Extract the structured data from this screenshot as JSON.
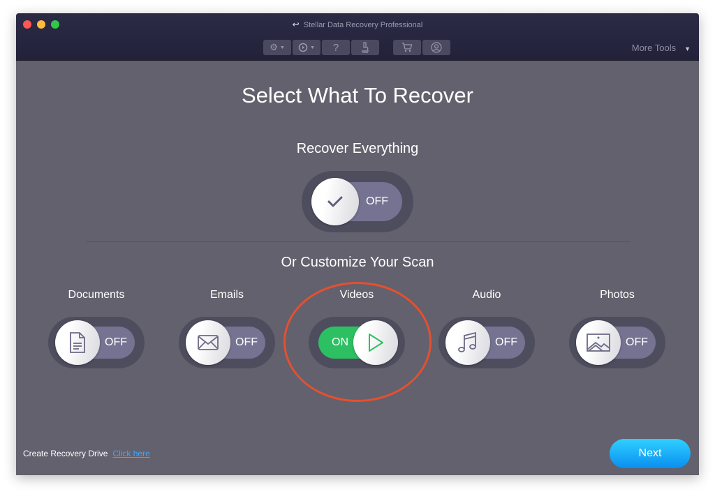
{
  "window": {
    "title": "Stellar Data Recovery Professional",
    "more_tools_label": "More Tools",
    "toolbar": [
      {
        "icon": "gear-icon",
        "has_dropdown": true
      },
      {
        "icon": "history-icon",
        "has_dropdown": true
      },
      {
        "icon": "help-icon",
        "label": "?"
      },
      {
        "icon": "microscope-icon"
      },
      {
        "icon": "cart-icon"
      },
      {
        "icon": "user-icon"
      }
    ]
  },
  "main": {
    "heading": "Select What To Recover",
    "recover_everything": {
      "label": "Recover Everything",
      "state": "OFF",
      "icon": "check-icon"
    },
    "customize_label": "Or Customize Your Scan",
    "categories": [
      {
        "label": "Documents",
        "state": "OFF",
        "icon": "document-icon"
      },
      {
        "label": "Emails",
        "state": "OFF",
        "icon": "email-icon"
      },
      {
        "label": "Videos",
        "state": "ON",
        "icon": "play-icon"
      },
      {
        "label": "Audio",
        "state": "OFF",
        "icon": "music-icon"
      },
      {
        "label": "Photos",
        "state": "OFF",
        "icon": "photo-icon"
      }
    ]
  },
  "footer": {
    "create_drive_label": "Create Recovery Drive",
    "click_here_link": "Click here",
    "next_button": "Next"
  },
  "colors": {
    "on_green": "#2dc063",
    "annotation_red": "#e5502f",
    "next_blue": "#1aaef8",
    "link_blue": "#3fa7ff"
  }
}
